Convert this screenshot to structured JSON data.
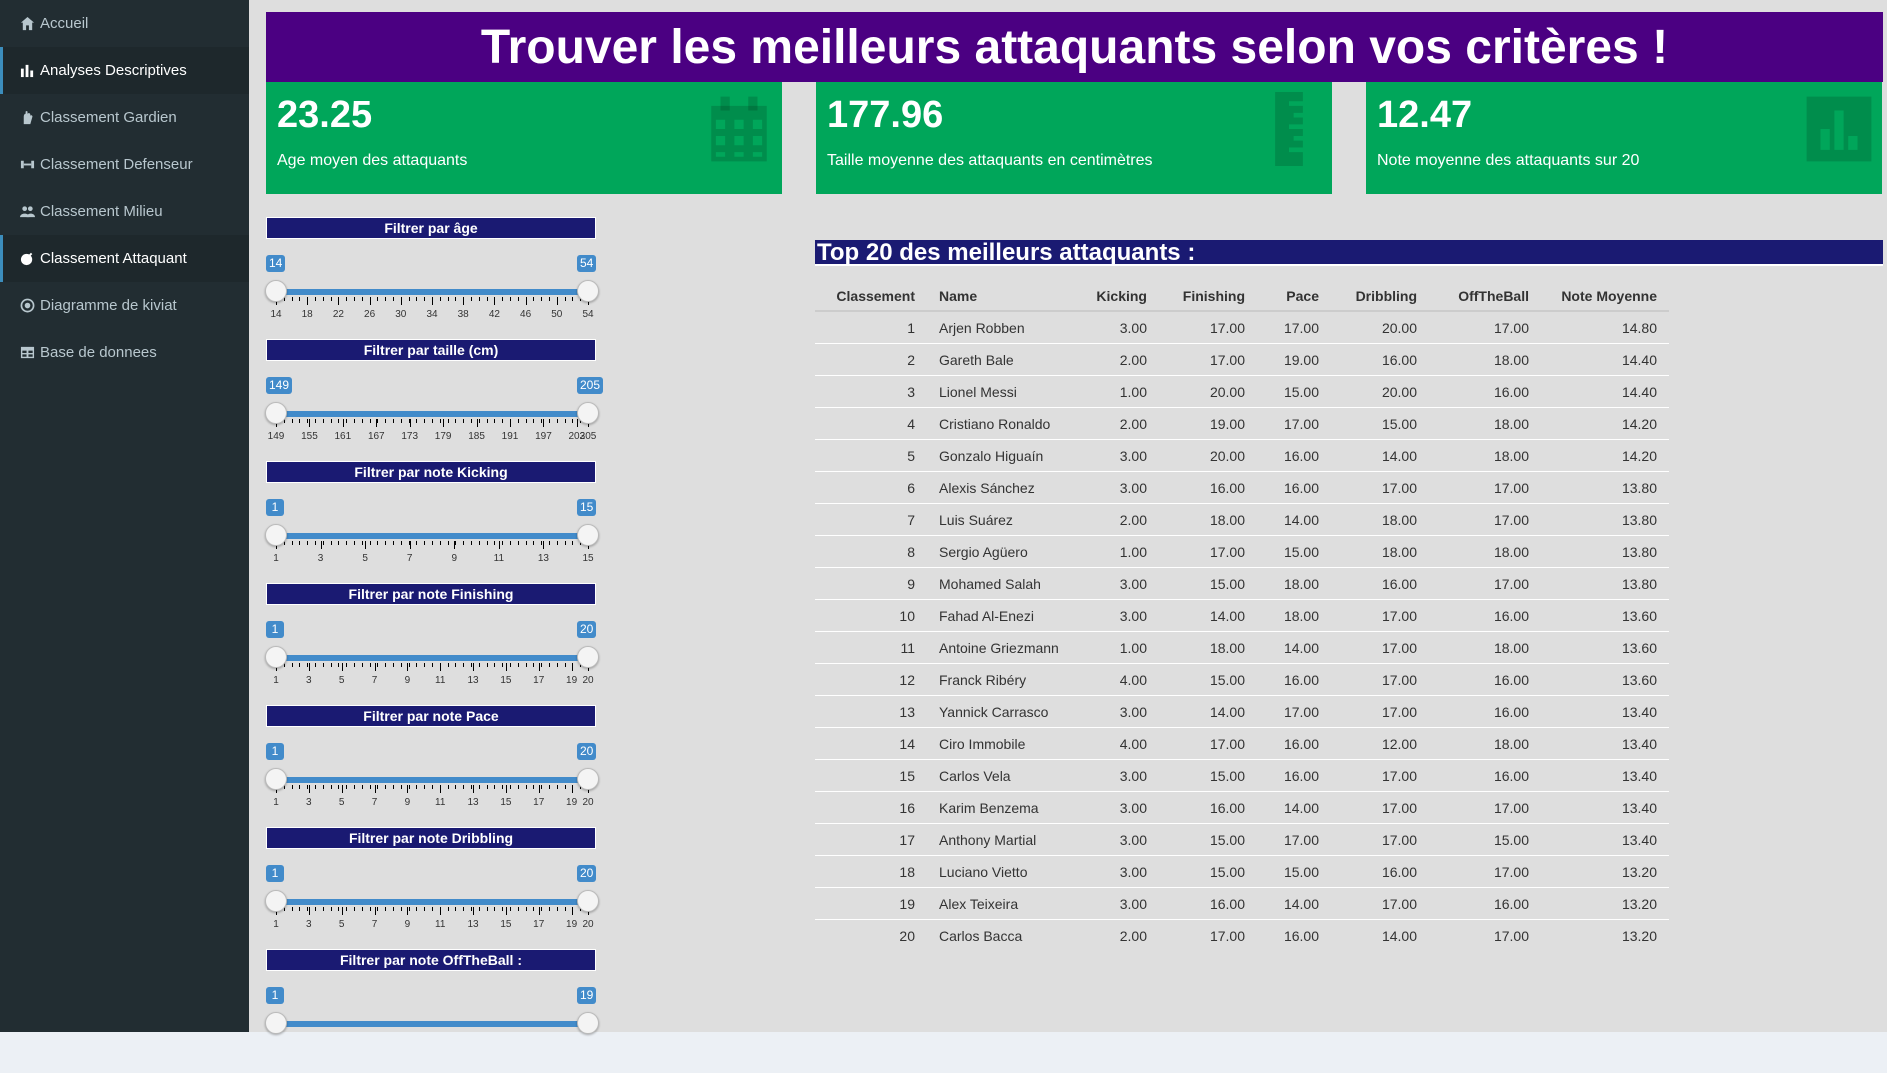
{
  "sidebar": {
    "items": [
      {
        "label": "Accueil",
        "icon": "home-icon",
        "active": false
      },
      {
        "label": "Analyses Descriptives",
        "icon": "bar-chart-icon",
        "active": true
      },
      {
        "label": "Classement Gardien",
        "icon": "glove-icon",
        "active": false
      },
      {
        "label": "Classement Defenseur",
        "icon": "dumbbell-icon",
        "active": false
      },
      {
        "label": "Classement Milieu",
        "icon": "users-icon",
        "active": false
      },
      {
        "label": "Classement Attaquant",
        "icon": "bomb-icon",
        "active": true
      },
      {
        "label": "Diagramme de kiviat",
        "icon": "dot-circle-icon",
        "active": false
      },
      {
        "label": "Base de donnees",
        "icon": "table-icon",
        "active": false
      }
    ]
  },
  "banner": {
    "title": "Trouver les meilleurs attaquants selon vos critères !"
  },
  "valueboxes": [
    {
      "value": "23.25",
      "label": "Age moyen des attaquants",
      "icon": "calendar-icon"
    },
    {
      "value": "177.96",
      "label": "Taille moyenne des attaquants en centimètres",
      "icon": "ruler-icon"
    },
    {
      "value": "12.47",
      "label": "Note moyenne des attaquants sur 20",
      "icon": "bar-chart-icon"
    }
  ],
  "filters": [
    {
      "title": "Filtrer par âge",
      "min": 14,
      "max": 54,
      "from": 14,
      "to": 54,
      "ticks": [
        "14",
        "18",
        "22",
        "26",
        "30",
        "34",
        "38",
        "42",
        "46",
        "50",
        "54"
      ]
    },
    {
      "title": "Filtrer par taille (cm)",
      "min": 149,
      "max": 205,
      "from": 149,
      "to": 205,
      "ticks": [
        "149",
        "155",
        "161",
        "167",
        "173",
        "179",
        "185",
        "191",
        "197",
        "203",
        "205"
      ]
    },
    {
      "title": "Filtrer par note Kicking",
      "min": 1,
      "max": 15,
      "from": 1,
      "to": 15,
      "ticks": [
        "1",
        "3",
        "5",
        "7",
        "9",
        "11",
        "13",
        "15"
      ]
    },
    {
      "title": "Filtrer par note Finishing",
      "min": 1,
      "max": 20,
      "from": 1,
      "to": 20,
      "ticks": [
        "1",
        "3",
        "5",
        "7",
        "9",
        "11",
        "13",
        "15",
        "17",
        "19",
        "20"
      ]
    },
    {
      "title": "Filtrer par note Pace",
      "min": 1,
      "max": 20,
      "from": 1,
      "to": 20,
      "ticks": [
        "1",
        "3",
        "5",
        "7",
        "9",
        "11",
        "13",
        "15",
        "17",
        "19",
        "20"
      ]
    },
    {
      "title": "Filtrer par note Dribbling",
      "min": 1,
      "max": 20,
      "from": 1,
      "to": 20,
      "ticks": [
        "1",
        "3",
        "5",
        "7",
        "9",
        "11",
        "13",
        "15",
        "17",
        "19",
        "20"
      ]
    },
    {
      "title": "Filtrer par note OffTheBall :",
      "min": 1,
      "max": 19,
      "from": 1,
      "to": 19,
      "ticks": []
    }
  ],
  "table": {
    "title": "Top 20 des meilleurs attaquants :",
    "headers": [
      "Classement",
      "Name",
      "Kicking",
      "Finishing",
      "Pace",
      "Dribbling",
      "OffTheBall",
      "Note Moyenne"
    ],
    "rows": [
      [
        "1",
        "Arjen Robben",
        "3.00",
        "17.00",
        "17.00",
        "20.00",
        "17.00",
        "14.80"
      ],
      [
        "2",
        "Gareth Bale",
        "2.00",
        "17.00",
        "19.00",
        "16.00",
        "18.00",
        "14.40"
      ],
      [
        "3",
        "Lionel Messi",
        "1.00",
        "20.00",
        "15.00",
        "20.00",
        "16.00",
        "14.40"
      ],
      [
        "4",
        "Cristiano Ronaldo",
        "2.00",
        "19.00",
        "17.00",
        "15.00",
        "18.00",
        "14.20"
      ],
      [
        "5",
        "Gonzalo Higuaín",
        "3.00",
        "20.00",
        "16.00",
        "14.00",
        "18.00",
        "14.20"
      ],
      [
        "6",
        "Alexis Sánchez",
        "3.00",
        "16.00",
        "16.00",
        "17.00",
        "17.00",
        "13.80"
      ],
      [
        "7",
        "Luis Suárez",
        "2.00",
        "18.00",
        "14.00",
        "18.00",
        "17.00",
        "13.80"
      ],
      [
        "8",
        "Sergio Agüero",
        "1.00",
        "17.00",
        "15.00",
        "18.00",
        "18.00",
        "13.80"
      ],
      [
        "9",
        "Mohamed Salah",
        "3.00",
        "15.00",
        "18.00",
        "16.00",
        "17.00",
        "13.80"
      ],
      [
        "10",
        "Fahad Al-Enezi",
        "3.00",
        "14.00",
        "18.00",
        "17.00",
        "16.00",
        "13.60"
      ],
      [
        "11",
        "Antoine Griezmann",
        "1.00",
        "18.00",
        "14.00",
        "17.00",
        "18.00",
        "13.60"
      ],
      [
        "12",
        "Franck Ribéry",
        "4.00",
        "15.00",
        "16.00",
        "17.00",
        "16.00",
        "13.60"
      ],
      [
        "13",
        "Yannick Carrasco",
        "3.00",
        "14.00",
        "17.00",
        "17.00",
        "16.00",
        "13.40"
      ],
      [
        "14",
        "Ciro Immobile",
        "4.00",
        "17.00",
        "16.00",
        "12.00",
        "18.00",
        "13.40"
      ],
      [
        "15",
        "Carlos Vela",
        "3.00",
        "15.00",
        "16.00",
        "17.00",
        "16.00",
        "13.40"
      ],
      [
        "16",
        "Karim Benzema",
        "3.00",
        "16.00",
        "14.00",
        "17.00",
        "17.00",
        "13.40"
      ],
      [
        "17",
        "Anthony Martial",
        "3.00",
        "15.00",
        "17.00",
        "17.00",
        "15.00",
        "13.40"
      ],
      [
        "18",
        "Luciano Vietto",
        "3.00",
        "15.00",
        "15.00",
        "16.00",
        "17.00",
        "13.20"
      ],
      [
        "19",
        "Alex Teixeira",
        "3.00",
        "16.00",
        "14.00",
        "17.00",
        "16.00",
        "13.20"
      ],
      [
        "20",
        "Carlos Bacca",
        "2.00",
        "17.00",
        "16.00",
        "14.00",
        "17.00",
        "13.20"
      ]
    ]
  }
}
